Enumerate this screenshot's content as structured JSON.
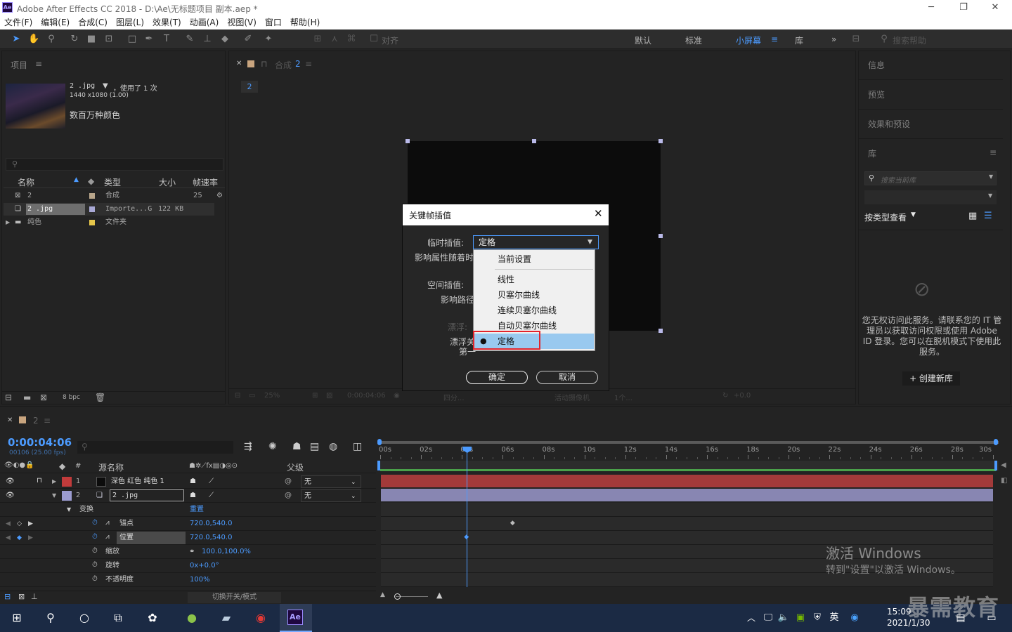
{
  "window": {
    "logo": "Ae",
    "title": "Adobe After Effects CC 2018 - D:\\Ae\\无标题项目 副本.aep *",
    "minimize_icon": "minimize-icon",
    "restore_icon": "restore-icon",
    "close_icon": "close-icon"
  },
  "menu": [
    "文件(F)",
    "编辑(E)",
    "合成(C)",
    "图层(L)",
    "效果(T)",
    "动画(A)",
    "视图(V)",
    "窗口",
    "帮助(H)"
  ],
  "toolbar": {
    "align_label": "对齐",
    "workspaces": [
      "默认",
      "标准",
      "小屏幕",
      "库"
    ],
    "active_workspace": "小屏幕",
    "more": "»",
    "search_placeholder": "搜索帮助"
  },
  "project": {
    "title": "项目",
    "item_name": "2 .jpg",
    "item_used": "，使用了 1 次",
    "item_dims": "1440 x1080 (1.00)",
    "item_colors": "数百万种颜色",
    "columns": [
      "名称",
      "类型",
      "大小",
      "帧速率"
    ],
    "rows": [
      {
        "name": "2",
        "type": "合成",
        "size": "",
        "fps": "25",
        "swatch": "#b8a58a"
      },
      {
        "name": "2 .jpg",
        "type": "Importe...G",
        "size": "122 KB",
        "fps": "",
        "swatch": "#a9a9d6"
      },
      {
        "name": "纯色",
        "type": "文件夹",
        "size": "",
        "fps": "",
        "swatch": "#e6c64a"
      }
    ],
    "bpc": "8 bpc"
  },
  "composition": {
    "tab": "合成 2",
    "breadcrumb": "2",
    "zoom": "25%",
    "timecode": "0:00:04:06",
    "res": "四分...",
    "camera": "活动摄像机",
    "views": "1个...",
    "exposure": "+0.0"
  },
  "dialog": {
    "title": "关键帧插值",
    "temporal_label": "临时插值:",
    "temporal_value": "定格",
    "affects_label": "影响属性随着时",
    "spatial_label": "空间插值:",
    "spatial_affects": "影响路径",
    "roving_label": "漂浮:",
    "roving_desc_1": "漂浮关",
    "roving_desc_2": "第一",
    "ok": "确定",
    "cancel": "取消",
    "options": [
      "当前设置",
      "线性",
      "贝塞尔曲线",
      "连续贝塞尔曲线",
      "自动贝塞尔曲线",
      "定格"
    ],
    "selected_option": "定格"
  },
  "right_panel": {
    "sections": [
      "信息",
      "预览",
      "效果和预设",
      "库"
    ],
    "library_search_placeholder": "搜索当前库",
    "view_by": "按类型查看",
    "access_message": "您无权访问此服务。请联系您的 IT 管理员以获取访问权限或使用 Adobe ID 登录。您可以在脱机模式下使用此服务。",
    "create_library": "+ 创建新库"
  },
  "timeline": {
    "tab": "2",
    "timecode": "0:00:04:06",
    "frame_info": "00106 (25.00 fps)",
    "columns": {
      "num": "#",
      "source": "源名称",
      "parent": "父级"
    },
    "layers": [
      {
        "num": "1",
        "name": "深色 红色 纯色 1",
        "parent": "无",
        "color": "#c23b3b"
      },
      {
        "num": "2",
        "name": "2 .jpg",
        "parent": "无",
        "color": "#9c9cd0"
      }
    ],
    "transform_label": "变换",
    "reset_label": "重置",
    "properties": [
      {
        "name": "锚点",
        "value": "720.0,540.0"
      },
      {
        "name": "位置",
        "value": "720.0,540.0"
      },
      {
        "name": "缩放",
        "value": "100.0,100.0%"
      },
      {
        "name": "旋转",
        "value": "0x+0.0°"
      },
      {
        "name": "不透明度",
        "value": "100%"
      }
    ],
    "ruler": [
      "00s",
      "02s",
      "04s",
      "06s",
      "08s",
      "10s",
      "12s",
      "14s",
      "16s",
      "18s",
      "20s",
      "22s",
      "24s",
      "26s",
      "28s",
      "30s"
    ],
    "playhead_seconds": 4.24,
    "duration_seconds": 30,
    "anchor_keyframe_seconds": 6.5,
    "position_keyframe_seconds": 4.24,
    "toggle_label": "切换开关/模式",
    "layer1_bar_color": "#a33a3a",
    "layer2_bar_color": "#8886b2"
  },
  "watermark": {
    "line1": "激活 Windows",
    "line2": "转到\"设置\"以激活 Windows。",
    "brand": "暴需教育"
  },
  "taskbar": {
    "time": "15:09",
    "date": "2021/1/30",
    "ime": "英",
    "ae_label": "Ae"
  }
}
